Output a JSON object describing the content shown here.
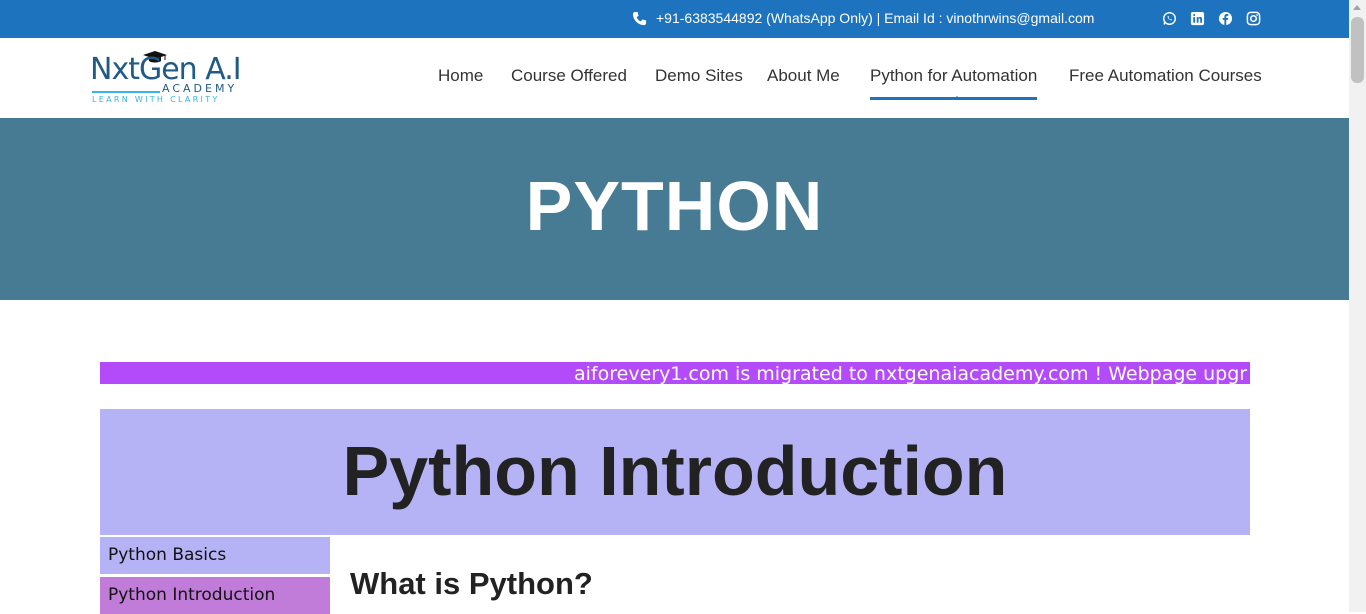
{
  "topbar": {
    "contact": "+91-6383544892 (WhatsApp Only) | Email Id : vinothrwins@gmail.com",
    "social_icons": [
      "whatsapp-icon",
      "linkedin-icon",
      "facebook-icon",
      "instagram-icon"
    ],
    "background": "#1e73be"
  },
  "logo": {
    "line1": "NxtGen A.I",
    "line2": "ACADEMY",
    "tagline": "LEARN WITH CLARITY"
  },
  "nav": {
    "items": [
      "Home",
      "Course Offered",
      "Demo Sites",
      "About Me",
      "Python for Automation",
      "Free Automation Courses"
    ],
    "active": "Python for Automation"
  },
  "hero": {
    "title": "PYTHON",
    "background": "#477a93"
  },
  "marquee": {
    "text": "aiforevery1.com is migrated to nxtgenaiacademy.com ! Webpage upgr",
    "background": "#b44bfa"
  },
  "intro": {
    "title": "Python Introduction",
    "background": "#b5b3f5"
  },
  "sidebar": {
    "items": [
      "Python Basics",
      "Python Introduction"
    ]
  },
  "content": {
    "heading": "What is Python?"
  }
}
